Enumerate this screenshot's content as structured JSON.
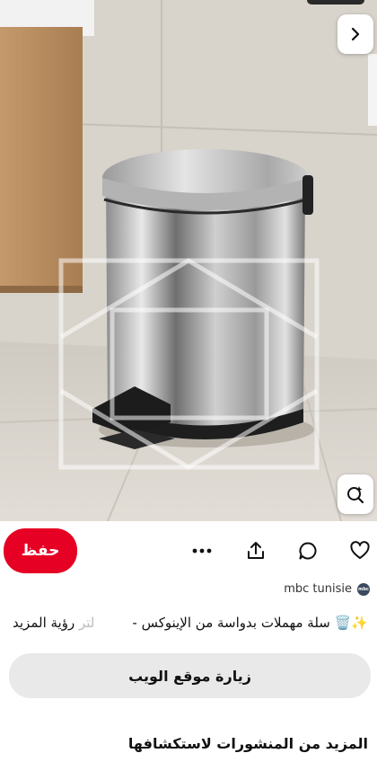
{
  "actions": {
    "save_label": "حفظ",
    "icons": [
      "heart-icon",
      "comment-icon",
      "share-icon",
      "more-icon"
    ]
  },
  "source": {
    "name": "mbc tunisie",
    "avatar_text": "mbc"
  },
  "description": {
    "text": "✨🗑️ سلة مهملات بدواسة من الإينوكس -",
    "see_more_fade": "لتر",
    "see_more": "رؤية المزيد"
  },
  "visit_button": {
    "label": "زيارة موقع الويب"
  },
  "more_section": {
    "title": "المزيد من المنشورات لاستكشافها"
  },
  "colors": {
    "save": "#e60023",
    "visit_bg": "#e9e9e9"
  }
}
